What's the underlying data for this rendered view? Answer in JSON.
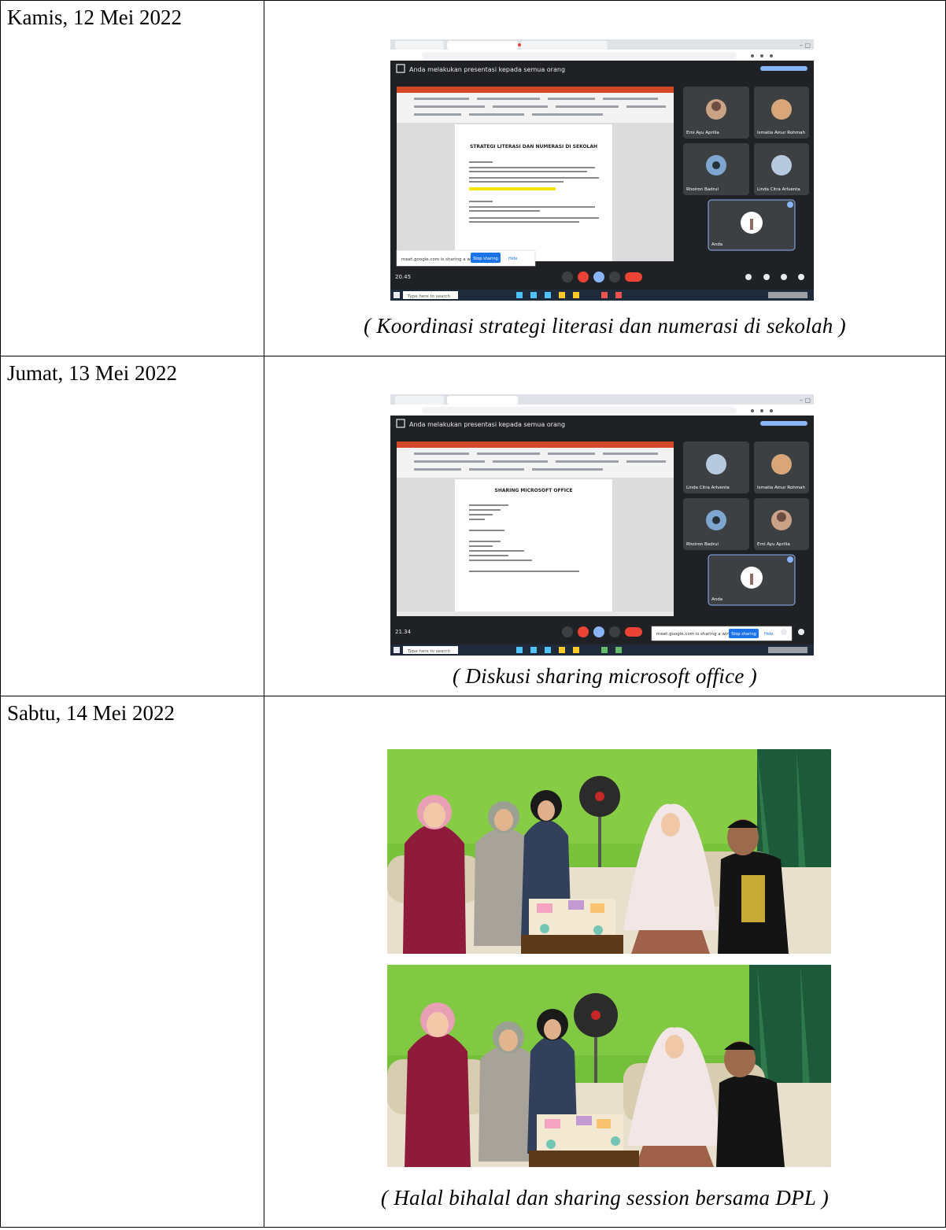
{
  "rows": [
    {
      "date": "Kamis, 12 Mei 2022",
      "caption": "( Koordinasi strategi literasi dan numerasi di sekolah )",
      "meet": {
        "banner": "Anda melakukan presentasi kepada semua orang",
        "doc_title": "STRATEGI LITERASI DAN NUMERASI DI SEKOLAH",
        "participants": [
          "Erni Ayu Aprilia",
          "Ismatia Ainur Rohmah",
          "Rhoiron Badrul",
          "Linda Citra Arlventa",
          "Anda"
        ],
        "time": "20.45",
        "notice": "meet.google.com is sharing a window.",
        "stop_label": "Stop sharing",
        "hide_label": "Hide",
        "taskbar_search": "Type here to search"
      }
    },
    {
      "date": "Jumat, 13 Mei 2022",
      "caption": "( Diskusi sharing microsoft office )",
      "meet": {
        "banner": "Anda melakukan presentasi kepada semua orang",
        "doc_title": "SHARING MICROSOFT OFFICE",
        "participants": [
          "Linda Citra Arlventa",
          "Ismatia Ainur Rohmah",
          "Rhoiron Badrul",
          "Erni Ayu Aprilia",
          "Anda"
        ],
        "time": "21.34",
        "notice": "meet.google.com is sharing a window.",
        "stop_label": "Stop sharing",
        "hide_label": "Hide",
        "taskbar_search": "Type here to search"
      }
    },
    {
      "date": "Sabtu, 14 Mei 2022",
      "caption": "( Halal bihalal dan sharing session bersama DPL )"
    }
  ],
  "colors": {
    "meet_bg": "#202124",
    "hangup": "#ea4335",
    "present_blue": "#8ab4f8",
    "stop_blue": "#1a73e8",
    "ppt_red": "#d24726",
    "wall_green": "#76c23a",
    "curtain_green": "#1d5a3a"
  }
}
